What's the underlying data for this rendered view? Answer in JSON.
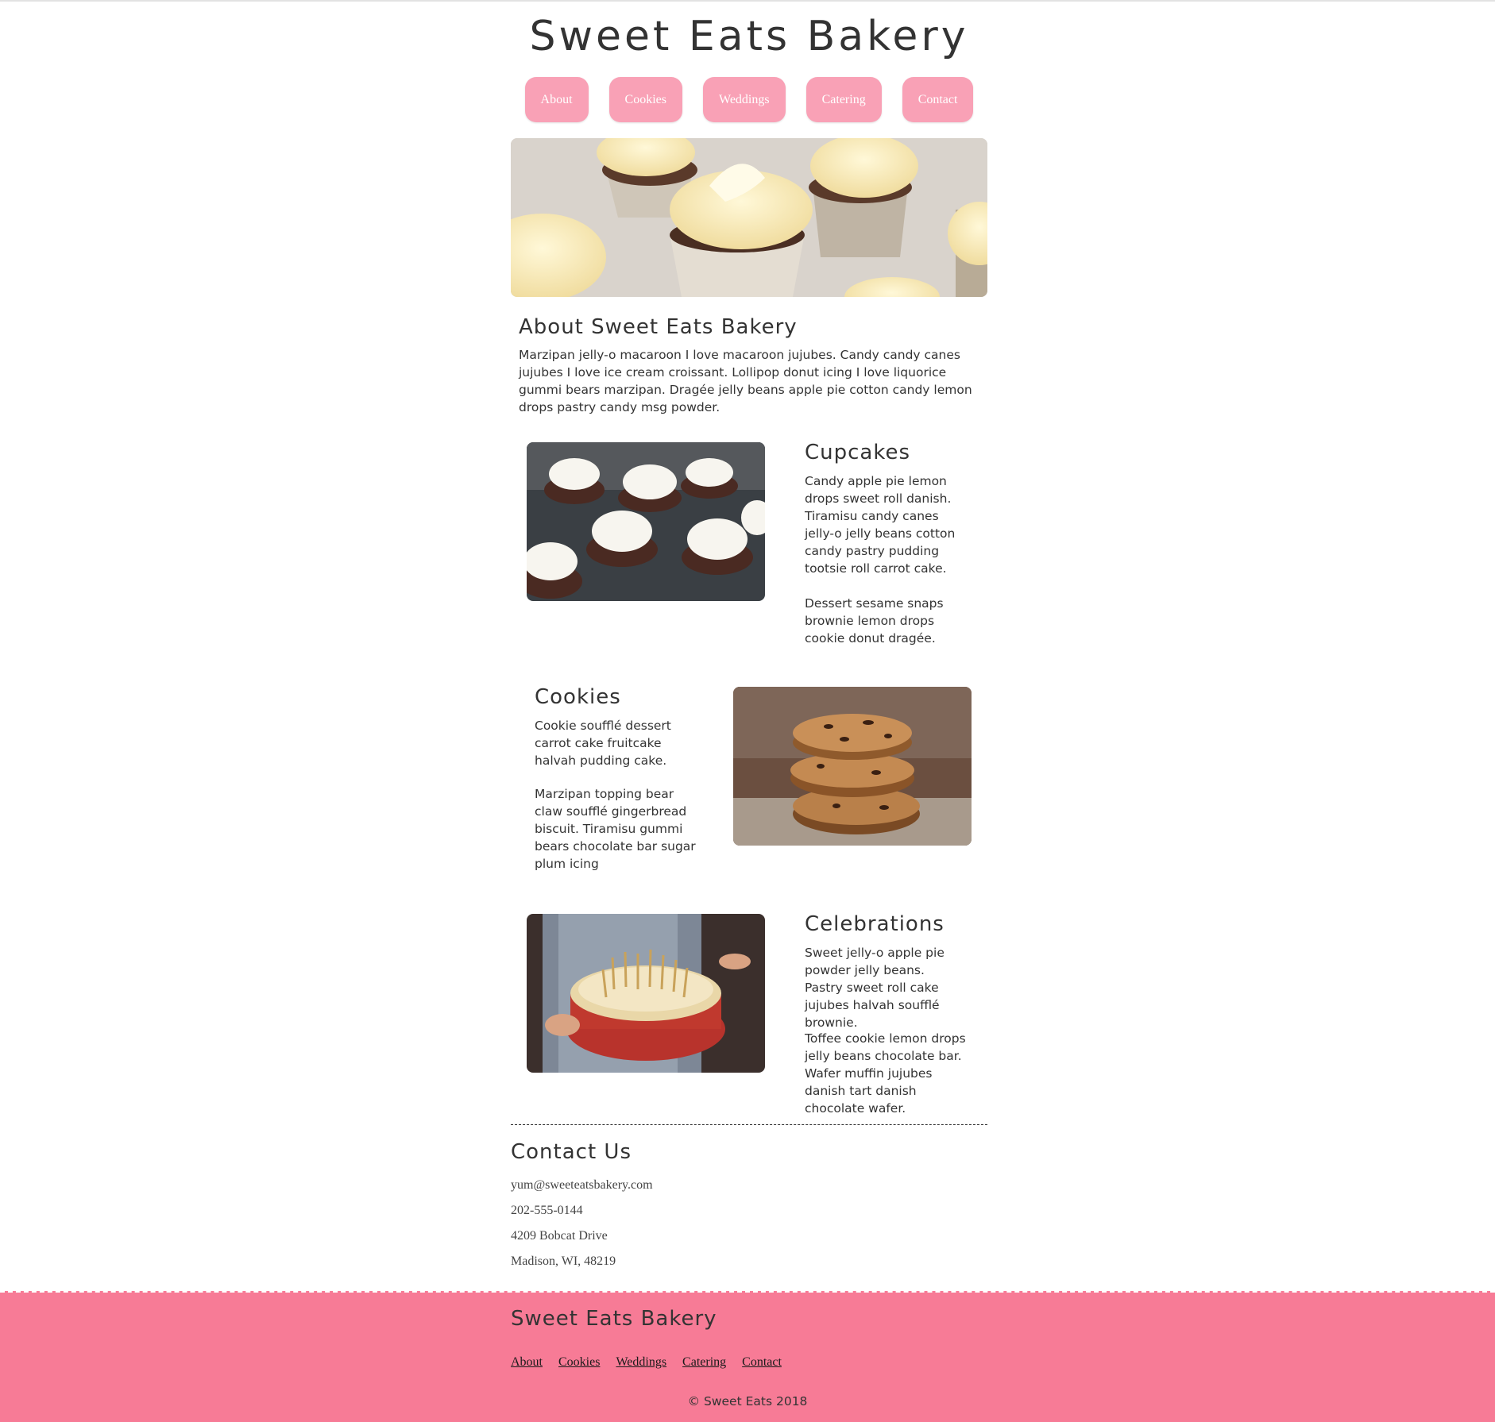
{
  "header": {
    "site_title": "Sweet Eats Bakery",
    "nav": [
      "About",
      "Cookies",
      "Weddings",
      "Catering",
      "Contact"
    ]
  },
  "about": {
    "title": "About Sweet Eats Bakery",
    "text": "Marzipan jelly-o macaroon I love macaroon jujubes. Candy candy canes jujubes I love ice cream croissant. Lollipop donut icing I love liquorice gummi bears marzipan. Dragée jelly beans apple pie cotton candy lemon drops pastry candy msg powder."
  },
  "sections": [
    {
      "title": "Cupcakes",
      "p1": "Candy apple pie lemon drops sweet roll danish. Tiramisu candy canes jelly-o jelly beans cotton candy pastry pudding tootsie roll carrot cake.",
      "p2": "Dessert sesame snaps brownie lemon drops cookie donut dragée."
    },
    {
      "title": "Cookies",
      "p1": "Cookie soufflé dessert carrot cake fruitcake halvah pudding cake.",
      "p2": "Marzipan topping bear claw soufflé gingerbread biscuit. Tiramisu gummi bears chocolate bar sugar plum icing"
    },
    {
      "title": "Celebrations",
      "p1": "Sweet jelly-o apple pie powder jelly beans. Pastry sweet roll cake jujubes halvah soufflé brownie.",
      "p2": "Toffee cookie lemon drops jelly beans chocolate bar. Wafer muffin jujubes danish tart danish chocolate wafer."
    }
  ],
  "contact": {
    "title": "Contact Us",
    "email": "yum@sweeteatsbakery.com",
    "phone": "202-555-0144",
    "street": "4209 Bobcat Drive",
    "city": "Madison, WI, 48219"
  },
  "footer": {
    "title": "Sweet Eats Bakery",
    "links": [
      "About",
      "Cookies",
      "Weddings",
      "Catering",
      "Contact"
    ],
    "copyright": "© Sweet Eats 2018"
  },
  "colors": {
    "nav_button": "#f9a1b6",
    "footer_bg": "#f77b96",
    "text": "#333333"
  }
}
